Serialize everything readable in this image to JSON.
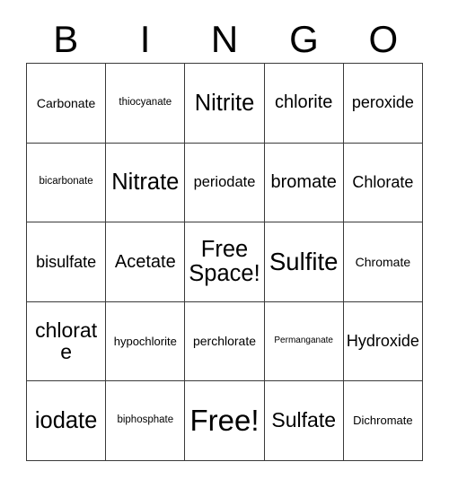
{
  "card": {
    "title": "BINGO",
    "header_letters": [
      "B",
      "I",
      "N",
      "G",
      "O"
    ],
    "border_color": "#3a3a3a",
    "background_color": "#ffffff",
    "text_color": "#000000",
    "rows": 5,
    "columns": 5,
    "cells": [
      [
        {
          "label": "Carbonate",
          "size": "fs-sm"
        },
        {
          "label": "thiocyanate",
          "size": "fs-xs"
        },
        {
          "label": "Nitrite",
          "size": "fs-xxl"
        },
        {
          "label": "chlorite",
          "size": "fs-l"
        },
        {
          "label": "peroxide",
          "size": "fs-ml"
        }
      ],
      [
        {
          "label": "bicarbonate",
          "size": "fs-xs"
        },
        {
          "label": "Nitrate",
          "size": "fs-xxl"
        },
        {
          "label": "periodate",
          "size": "fs-m"
        },
        {
          "label": "bromate",
          "size": "fs-l"
        },
        {
          "label": "Chlorate",
          "size": "fs-ml"
        }
      ],
      [
        {
          "label": "bisulfate",
          "size": "fs-ml"
        },
        {
          "label": "Acetate",
          "size": "fs-l"
        },
        {
          "label": "Free Space!",
          "size": "fs-xxl"
        },
        {
          "label": "Sulfite",
          "size": "fs-xxxl"
        },
        {
          "label": "Chromate",
          "size": "fs-sm"
        }
      ],
      [
        {
          "label": "chlorate",
          "size": "fs-xl"
        },
        {
          "label": "hypochlorite",
          "size": "fs-s"
        },
        {
          "label": "perchlorate",
          "size": "fs-sm"
        },
        {
          "label": "Permanganate",
          "size": "fs-xxs"
        },
        {
          "label": "Hydroxide",
          "size": "fs-ml"
        }
      ],
      [
        {
          "label": "iodate",
          "size": "fs-xxl"
        },
        {
          "label": "biphosphate",
          "size": "fs-xs"
        },
        {
          "label": "Free!",
          "size": "fs-huge"
        },
        {
          "label": "Sulfate",
          "size": "fs-xl"
        },
        {
          "label": "Dichromate",
          "size": "fs-s"
        }
      ]
    ]
  }
}
